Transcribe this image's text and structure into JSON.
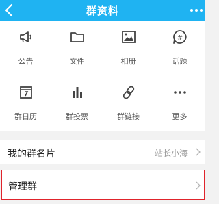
{
  "header": {
    "title": "群资料",
    "back_icon": "back-arrow-icon",
    "more_icon": "more-dots-icon",
    "background": "#1fb3f2"
  },
  "grid": {
    "items": [
      {
        "label": "公告",
        "icon": "megaphone-icon"
      },
      {
        "label": "文件",
        "icon": "folder-icon"
      },
      {
        "label": "相册",
        "icon": "photo-album-icon"
      },
      {
        "label": "话题",
        "icon": "topic-icon"
      },
      {
        "label": "群日历",
        "icon": "calendar-icon"
      },
      {
        "label": "群投票",
        "icon": "vote-icon"
      },
      {
        "label": "群链接",
        "icon": "link-icon"
      },
      {
        "label": "更多",
        "icon": "more-dots-icon"
      }
    ]
  },
  "rows": {
    "group_card": {
      "label": "我的群名片",
      "value": "站长小海"
    },
    "manage_group": {
      "label": "管理群"
    }
  },
  "colors": {
    "accent": "#1fb3f2",
    "highlight_border": "#e0242c"
  }
}
